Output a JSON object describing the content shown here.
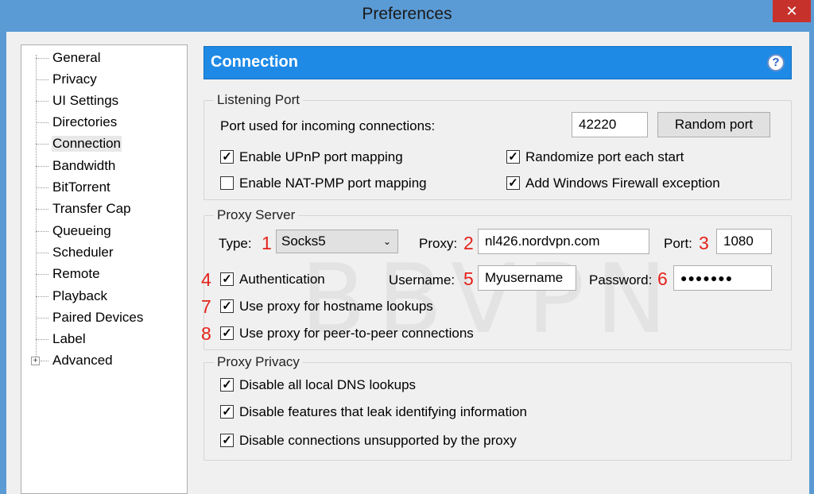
{
  "window": {
    "title": "Preferences",
    "close_glyph": "✕"
  },
  "sidebar": {
    "items": [
      {
        "label": "General"
      },
      {
        "label": "Privacy"
      },
      {
        "label": "UI Settings"
      },
      {
        "label": "Directories"
      },
      {
        "label": "Connection",
        "selected": true
      },
      {
        "label": "Bandwidth"
      },
      {
        "label": "BitTorrent"
      },
      {
        "label": "Transfer Cap"
      },
      {
        "label": "Queueing"
      },
      {
        "label": "Scheduler"
      },
      {
        "label": "Remote"
      },
      {
        "label": "Playback"
      },
      {
        "label": "Paired Devices"
      },
      {
        "label": "Label"
      },
      {
        "label": "Advanced",
        "expandable": true
      }
    ],
    "expander_glyph": "+"
  },
  "page": {
    "title": "Connection",
    "help_glyph": "?"
  },
  "listening_port": {
    "group_title": "Listening Port",
    "port_label": "Port used for incoming connections:",
    "port_value": "42220",
    "random_port_button": "Random port",
    "enable_upnp": {
      "label": "Enable UPnP port mapping",
      "checked": true
    },
    "enable_nat_pmp": {
      "label": "Enable NAT-PMP port mapping",
      "checked": false
    },
    "randomize_port": {
      "label": "Randomize port each start",
      "checked": true
    },
    "firewall_exception": {
      "label": "Add Windows Firewall exception",
      "checked": true
    }
  },
  "proxy_server": {
    "group_title": "Proxy Server",
    "type_label": "Type:",
    "type_value": "Socks5",
    "proxy_label": "Proxy:",
    "proxy_value": "nl426.nordvpn.com",
    "port_label": "Port:",
    "port_value": "1080",
    "authentication": {
      "label": "Authentication",
      "checked": true
    },
    "username_label": "Username:",
    "username_value": "Myusername",
    "password_label": "Password:",
    "password_value": "●●●●●●●",
    "hostname_lookups": {
      "label": "Use proxy for hostname lookups",
      "checked": true
    },
    "peer_connections": {
      "label": "Use proxy for peer-to-peer connections",
      "checked": true
    }
  },
  "proxy_privacy": {
    "group_title": "Proxy Privacy",
    "disable_dns": {
      "label": "Disable all local DNS lookups",
      "checked": true
    },
    "disable_leaks": {
      "label": "Disable features that leak identifying information",
      "checked": true
    },
    "disable_unsupported": {
      "label": "Disable connections unsupported by the proxy",
      "checked": true
    }
  },
  "annotations": [
    "1",
    "2",
    "3",
    "4",
    "5",
    "6",
    "7",
    "8"
  ],
  "watermark": "BBVPN",
  "check_glyph": "✓",
  "dropdown_glyph": "⌄",
  "colors": {
    "header": "#1e8ae6",
    "annotation": "#e4221b",
    "titlebar": "#5b9bd5",
    "close": "#c7312b"
  }
}
